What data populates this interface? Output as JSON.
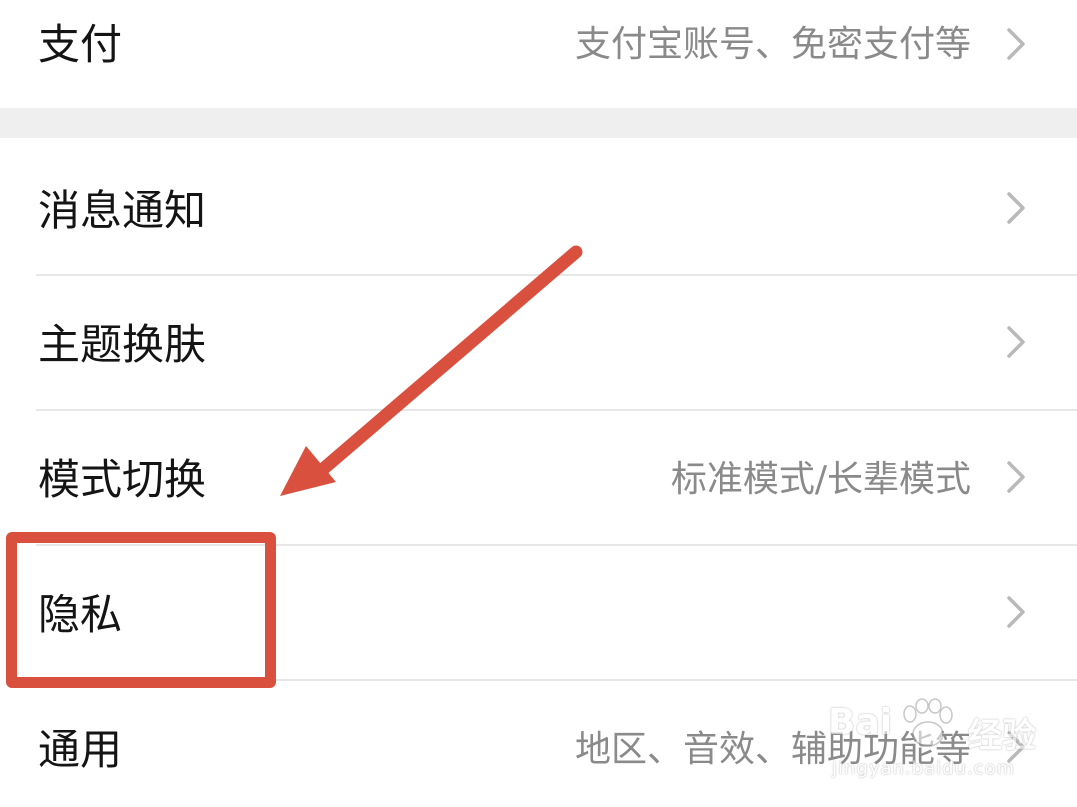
{
  "settings": {
    "items": [
      {
        "label": "支付",
        "detail": "支付宝账号、免密支付等"
      },
      {
        "label": "消息通知",
        "detail": ""
      },
      {
        "label": "主题换肤",
        "detail": ""
      },
      {
        "label": "模式切换",
        "detail": "标准模式/长辈模式"
      },
      {
        "label": "隐私",
        "detail": ""
      },
      {
        "label": "通用",
        "detail": "地区、音效、辅助功能等"
      }
    ]
  },
  "annotation": {
    "color": "#d9503f",
    "highlighted_item": "隐私"
  },
  "watermark": {
    "brand": "Bai",
    "brand_cn": "经验",
    "url": "jingyan.baidu.com"
  },
  "icons": {
    "chevron": "chevron-right-icon"
  }
}
